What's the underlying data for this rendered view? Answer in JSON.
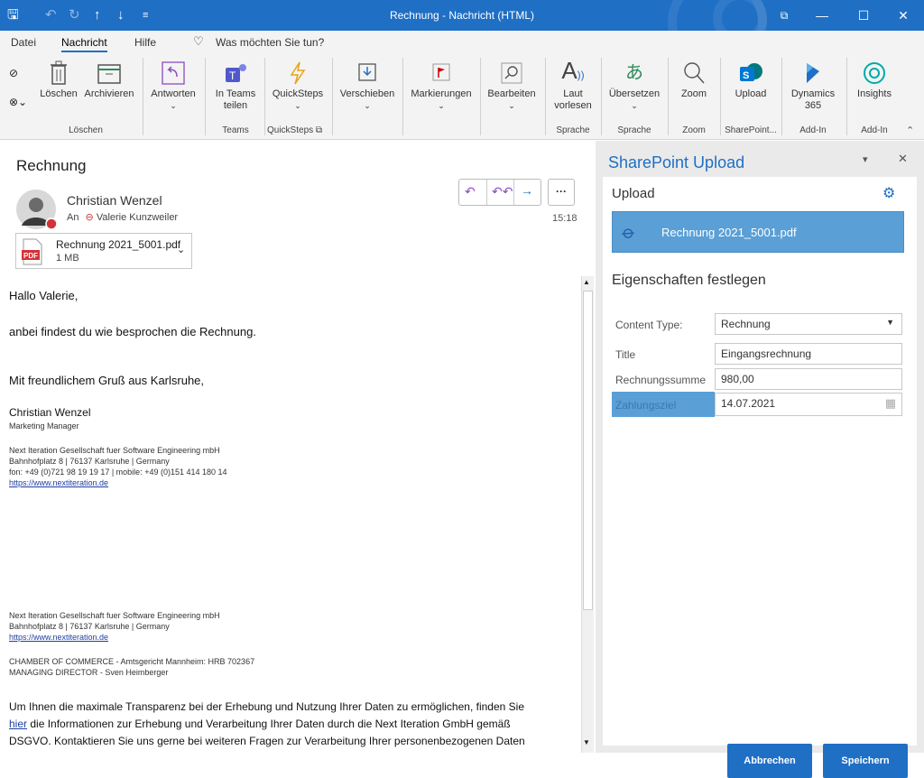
{
  "window": {
    "title": "Rechnung  -  Nachricht (HTML)",
    "minimize": "—",
    "maximize": "☐",
    "close": "✕",
    "ribbon_display": "⧉"
  },
  "menu": {
    "items": [
      "Datei",
      "Nachricht",
      "Hilfe"
    ],
    "tell_me": "Was möchten Sie tun?"
  },
  "ribbon": {
    "buttons": {
      "loeschen": "Löschen",
      "archivieren": "Archivieren",
      "antworten": "Antworten",
      "teams": "In Teams teilen",
      "quicksteps": "QuickSteps",
      "verschieben": "Verschieben",
      "markierungen": "Markierungen",
      "bearbeiten": "Bearbeiten",
      "laut": "Laut vorlesen",
      "uebersetzen": "Übersetzen",
      "zoom": "Zoom",
      "upload": "Upload",
      "dynamics": "Dynamics 365",
      "insights": "Insights"
    },
    "groups": {
      "loeschen": "Löschen",
      "teams": "Teams",
      "quicksteps": "QuickSteps",
      "sprache1": "Sprache",
      "sprache2": "Sprache",
      "zoom": "Zoom",
      "sharepoint": "SharePoint...",
      "addin1": "Add-In",
      "addin2": "Add-In"
    }
  },
  "email": {
    "subject": "Rechnung",
    "sender": "Christian Wenzel",
    "to_prefix": "An",
    "to_name": "Valerie Kunzweiler",
    "time": "15:18",
    "attachment": {
      "name": "Rechnung 2021_5001.pdf",
      "size": "1 MB",
      "type": "PDF"
    },
    "greeting": "Hallo Valerie,",
    "line1": "anbei findest du wie besprochen die Rechnung.",
    "closing": "Mit freundlichem Gruß aus Karlsruhe,",
    "sig_name": "Christian Wenzel",
    "sig_title": "Marketing Manager",
    "sig_company": "Next Iteration Gesellschaft fuer Software Engineering mbH",
    "sig_address": "Bahnhofplatz 8 | 76137 Karlsruhe | Germany",
    "sig_phone": "fon: +49 (0)721 98 19 19 17 | mobile: +49 (0)151 414 180 14",
    "sig_link": "https://www.nextiteration.de",
    "footer_company": "Next Iteration Gesellschaft fuer Software Engineering mbH",
    "footer_address": "Bahnhofplatz 8 | 76137 Karlsruhe | Germany",
    "footer_link": "https://www.nextiteration.de",
    "footer_chamber": "CHAMBER OF COMMERCE - Amtsgericht Mannheim: HRB 702367",
    "footer_director": "MANAGING DIRECTOR - Sven Heimberger",
    "privacy_1": "Um Ihnen die maximale Transparenz bei der Erhebung und Nutzung Ihrer Daten zu ermöglichen, finden Sie",
    "privacy_link": "hier",
    "privacy_2": " die Informationen zur Erhebung und Verarbeitung Ihrer Daten durch die Next Iteration GmbH gemäß",
    "privacy_3": "DSGVO.  Kontaktieren Sie uns gerne bei weiteren Fragen zur Verarbeitung Ihrer personenbezogenen Daten"
  },
  "pane": {
    "title": "SharePoint Upload",
    "upload_heading": "Upload",
    "file": "Rechnung 2021_5001.pdf",
    "props_heading": "Eigenschaften festlegen",
    "fields": {
      "content_type_label": "Content Type:",
      "content_type_value": "Rechnung",
      "title_label": "Title",
      "title_value": "Eingangsrechnung",
      "sum_label": "Rechnungssumme",
      "sum_value": "980,00",
      "due_label": "Zahlungsziel",
      "due_value": "14.07.2021"
    },
    "cancel": "Abbrechen",
    "save": "Speichern",
    "close": "✕",
    "menu": "▾"
  },
  "colors": {
    "accent": "#1f6fc5",
    "upload_bar": "#5a9fd6",
    "pdf_red": "#d13438"
  }
}
